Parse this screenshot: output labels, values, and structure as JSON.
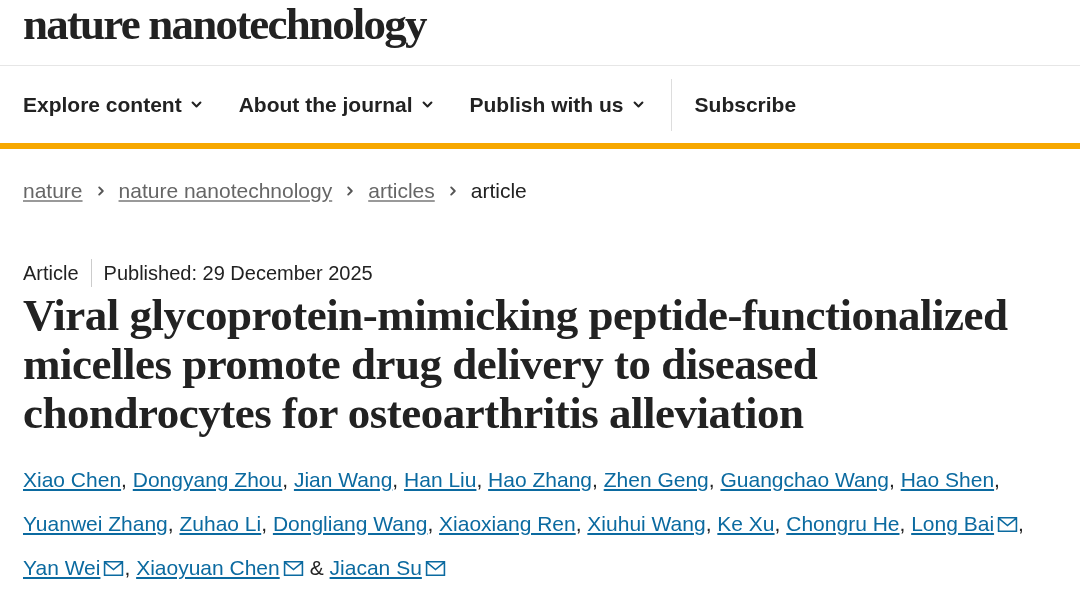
{
  "header": {
    "logo": "nature nanotechnology"
  },
  "nav": [
    {
      "label": "Explore content",
      "dropdown": true
    },
    {
      "label": "About the journal",
      "dropdown": true
    },
    {
      "label": "Publish with us",
      "dropdown": true
    },
    {
      "label": "Subscribe",
      "dropdown": false
    }
  ],
  "breadcrumbs": [
    {
      "label": "nature",
      "link": true
    },
    {
      "label": "nature nanotechnology",
      "link": true
    },
    {
      "label": "articles",
      "link": true
    },
    {
      "label": "article",
      "link": false
    }
  ],
  "article": {
    "type": "Article",
    "published": "Published: 29 December 2025",
    "title": "Viral glycoprotein-mimicking peptide-functionalized micelles promote drug delivery to diseased chondrocytes for osteoarthritis alleviation",
    "authors": [
      {
        "name": "Xiao Chen",
        "email": false,
        "sep": ","
      },
      {
        "name": "Dongyang Zhou",
        "email": false,
        "sep": ","
      },
      {
        "name": "Jian Wang",
        "email": false,
        "sep": ","
      },
      {
        "name": "Han Liu",
        "email": false,
        "sep": ","
      },
      {
        "name": "Hao Zhang",
        "email": false,
        "sep": ","
      },
      {
        "name": "Zhen Geng",
        "email": false,
        "sep": ","
      },
      {
        "name": "Guangchao Wang",
        "email": false,
        "sep": ","
      },
      {
        "name": "Hao Shen",
        "email": false,
        "sep": ","
      },
      {
        "name": "Yuanwei Zhang",
        "email": false,
        "sep": ","
      },
      {
        "name": "Zuhao Li",
        "email": false,
        "sep": ","
      },
      {
        "name": "Dongliang Wang",
        "email": false,
        "sep": ","
      },
      {
        "name": "Xiaoxiang Ren",
        "email": false,
        "sep": ","
      },
      {
        "name": "Xiuhui Wang",
        "email": false,
        "sep": ","
      },
      {
        "name": "Ke Xu",
        "email": false,
        "sep": ","
      },
      {
        "name": "Chongru He",
        "email": false,
        "sep": ","
      },
      {
        "name": "Long Bai",
        "email": true,
        "sep": ","
      },
      {
        "name": "Yan Wei",
        "email": true,
        "sep": ","
      },
      {
        "name": "Xiaoyuan Chen",
        "email": true,
        "sep": "&"
      },
      {
        "name": "Jiacan Su",
        "email": true
      }
    ]
  }
}
